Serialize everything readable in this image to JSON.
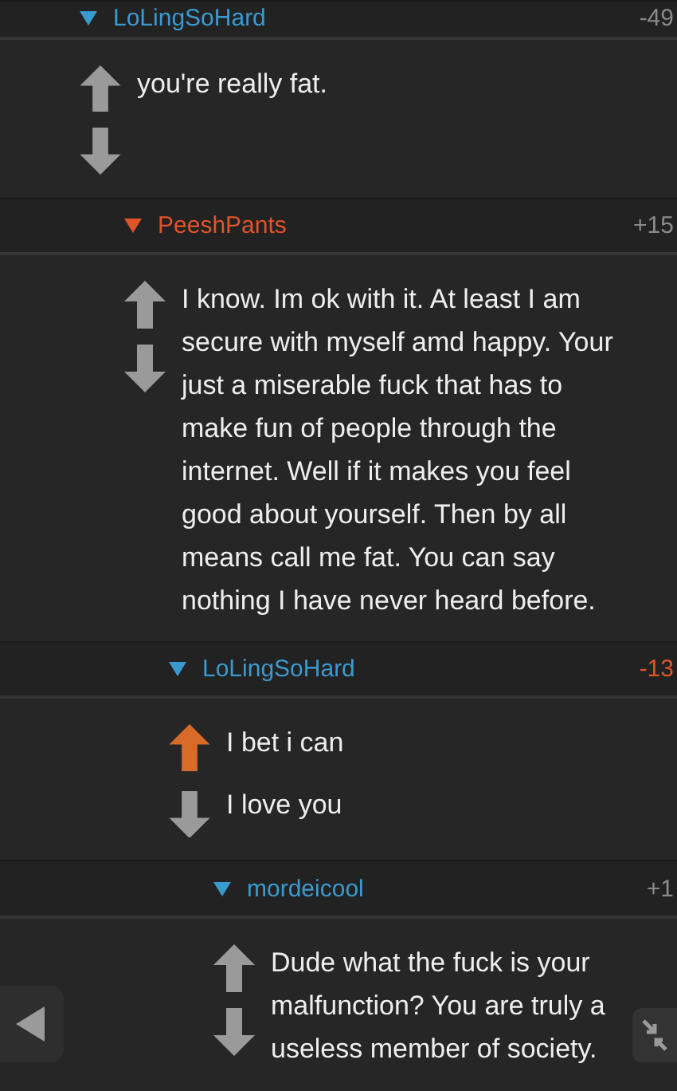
{
  "comments": [
    {
      "author": {
        "name": "LoLingSoHard",
        "color": "#3a9ad0"
      },
      "score": {
        "text": "-49",
        "color": "#8a8a8a"
      },
      "upvoted": false,
      "downvoted": false,
      "body": [
        "you're really fat."
      ],
      "children": [
        {
          "author": {
            "name": "PeeshPants",
            "color": "#e0542a"
          },
          "score": {
            "text": "+15",
            "color": "#8a8a8a"
          },
          "upvoted": false,
          "downvoted": false,
          "body": [
            "I know. Im ok with it. At least I am secure with myself amd happy. Your just a miserable fuck that has to make fun of people through the internet.  Well if it makes you feel good about yourself. Then by all means call me fat. You can say nothing I have never heard before."
          ],
          "children": [
            {
              "author": {
                "name": "LoLingSoHard",
                "color": "#3a9ad0"
              },
              "score": {
                "text": "-13",
                "color": "#e0542a"
              },
              "upvoted": true,
              "downvoted": false,
              "body": [
                "I bet i can",
                "I love you"
              ],
              "children": [
                {
                  "author": {
                    "name": "mordeicool",
                    "color": "#3a9ad0"
                  },
                  "score": {
                    "text": "+1",
                    "color": "#8a8a8a"
                  },
                  "upvoted": false,
                  "downvoted": false,
                  "body": [
                    "Dude what the fuck is your malfunction? You are truly a useless member of society."
                  ]
                }
              ]
            }
          ]
        }
      ]
    }
  ]
}
